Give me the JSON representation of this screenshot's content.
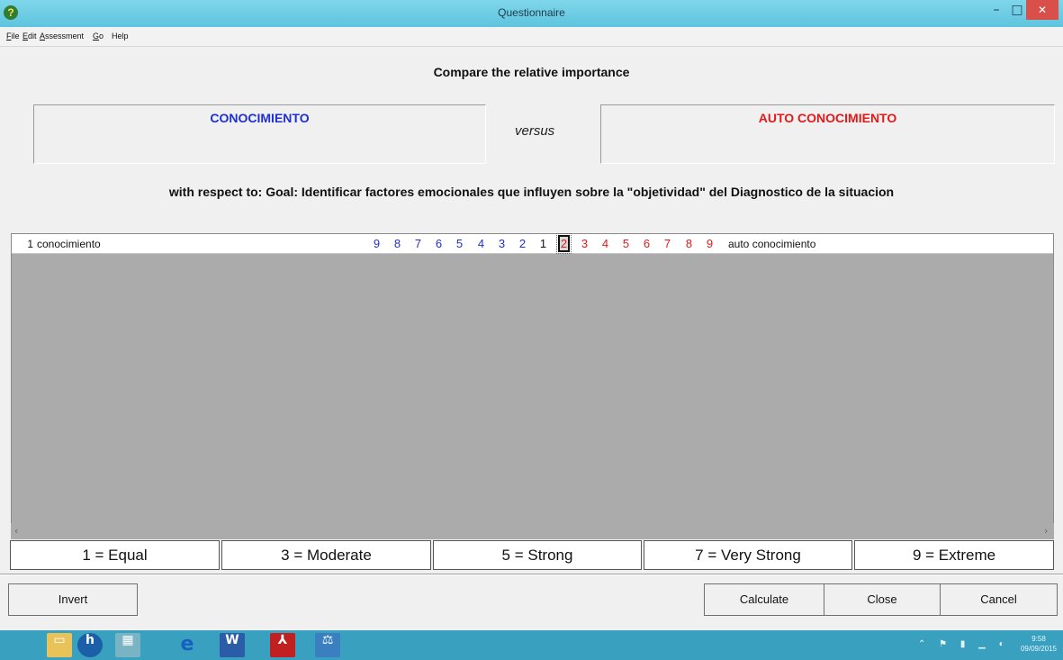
{
  "window": {
    "title": "Questionnaire",
    "minimize": "–",
    "maximize": "□",
    "close": "✕"
  },
  "menu": [
    {
      "label": "File",
      "u": "F",
      "rest": "ile"
    },
    {
      "label": "Edit",
      "u": "E",
      "rest": "dit"
    },
    {
      "label": "Assessment",
      "u": "A",
      "rest": "ssessment"
    },
    {
      "label": "Go",
      "u": "G",
      "rest": "o"
    },
    {
      "label": "Help",
      "u": "",
      "rest": "Help"
    }
  ],
  "prompt": "Compare the relative importance",
  "left_item": "CONOCIMIENTO",
  "right_item": "AUTO CONOCIMIENTO",
  "versus": "versus",
  "respect": "with respect to: Goal: Identificar factores emocionales que influyen sobre la \"objetividad\" del Diagnostico de la situacion",
  "row": {
    "index": "1",
    "left": "conocimiento",
    "right": "auto conocimiento",
    "scale": [
      "9",
      "8",
      "7",
      "6",
      "5",
      "4",
      "3",
      "2",
      "1",
      "2",
      "3",
      "4",
      "5",
      "6",
      "7",
      "8",
      "9"
    ],
    "selected_index": 9
  },
  "legend": [
    "1 = Equal",
    "3 = Moderate",
    "5 = Strong",
    "7 = Very Strong",
    "9 = Extreme"
  ],
  "buttons": {
    "invert": "Invert",
    "calculate": "Calculate",
    "close": "Close",
    "cancel": "Cancel"
  },
  "colors": {
    "left_accent": "#1f2fd0",
    "right_accent": "#e01a1a",
    "titlebar": "#6ccde4",
    "taskbar": "#3aa0bf"
  },
  "taskbar": {
    "apps": [
      "file-explorer-icon",
      "hp-icon",
      "program-icon",
      "internet-explorer-icon",
      "word-icon",
      "acrobat-icon",
      "expert-choice-icon"
    ],
    "time": "9:58",
    "date": "09/09/2015"
  }
}
